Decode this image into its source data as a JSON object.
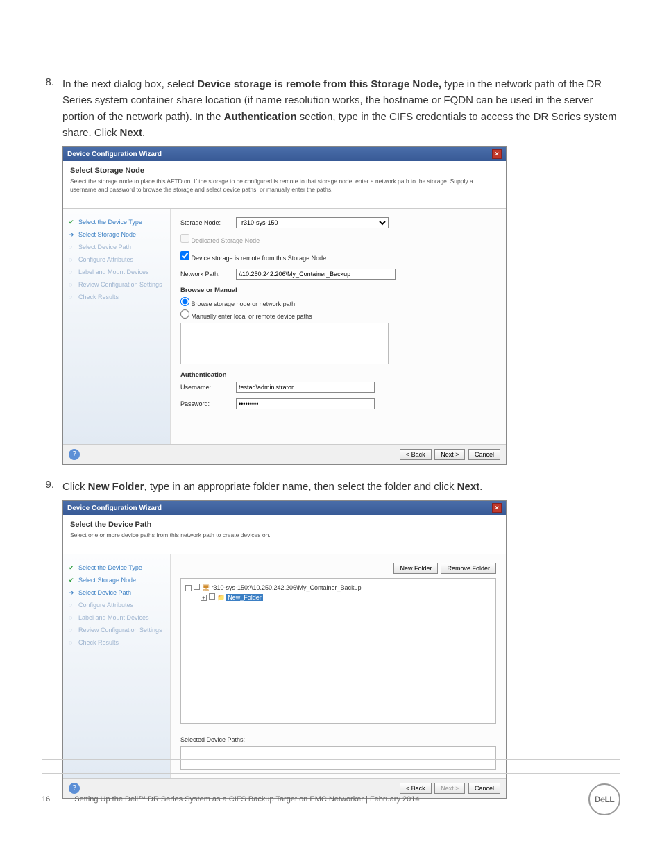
{
  "steps": {
    "s8": {
      "num": "8.",
      "text_parts": [
        "In the next dialog box, select ",
        "Device storage is remote from this Storage Node,",
        " type in the network path of the DR Series system container share location (if name resolution works, the hostname or FQDN can be used in the server portion of the network path). In the ",
        "Authentication",
        " section, type in the CIFS credentials to access the DR Series system share. Click ",
        "Next",
        "."
      ]
    },
    "s9": {
      "num": "9.",
      "text_parts": [
        "Click ",
        "New Folder",
        ", type in an appropriate folder name, then select the folder and click ",
        "Next",
        "."
      ]
    }
  },
  "wizard1": {
    "window_title": "Device Configuration Wizard",
    "header_title": "Select Storage Node",
    "header_sub": "Select the storage node to place this AFTD on. If the storage to be configured is remote to that storage node, enter a network path to the storage. Supply a username and password to browse the storage and select device paths, or manually enter the paths.",
    "side": [
      {
        "label": "Select the Device Type",
        "state": "done"
      },
      {
        "label": "Select Storage Node",
        "state": "current"
      },
      {
        "label": "Select Device Path",
        "state": ""
      },
      {
        "label": "Configure Attributes",
        "state": ""
      },
      {
        "label": "Label and Mount Devices",
        "state": ""
      },
      {
        "label": "Review Configuration Settings",
        "state": ""
      },
      {
        "label": "Check Results",
        "state": ""
      }
    ],
    "storage_node_label": "Storage Node:",
    "storage_node_value": "r310-sys-150",
    "dedicated_label": "Dedicated Storage Node",
    "remote_label": "Device storage is remote from this Storage Node.",
    "network_path_label": "Network Path:",
    "network_path_value": "\\\\10.250.242.206\\My_Container_Backup",
    "browse_section": "Browse or Manual",
    "radio_browse": "Browse storage node or network path",
    "radio_manual": "Manually enter local or remote device paths",
    "auth_section": "Authentication",
    "username_label": "Username:",
    "username_value": "testad\\administrator",
    "password_label": "Password:",
    "password_value": "•••••••••",
    "btn_back": "< Back",
    "btn_next": "Next >",
    "btn_cancel": "Cancel"
  },
  "wizard2": {
    "window_title": "Device Configuration Wizard",
    "header_title": "Select the Device Path",
    "header_sub": "Select one or more device paths from this network path to create devices on.",
    "side": [
      {
        "label": "Select the Device Type",
        "state": "done"
      },
      {
        "label": "Select Storage Node",
        "state": "done"
      },
      {
        "label": "Select Device Path",
        "state": "current"
      },
      {
        "label": "Configure Attributes",
        "state": ""
      },
      {
        "label": "Label and Mount Devices",
        "state": ""
      },
      {
        "label": "Review Configuration Settings",
        "state": ""
      },
      {
        "label": "Check Results",
        "state": ""
      }
    ],
    "btn_new_folder": "New Folder",
    "btn_remove_folder": "Remove Folder",
    "tree_root": "r310-sys-150:\\\\10.250.242.206\\My_Container_Backup",
    "tree_child": "New_Folder",
    "selected_paths_label": "Selected Device Paths:",
    "btn_back": "< Back",
    "btn_next": "Next >",
    "btn_cancel": "Cancel"
  },
  "footer": {
    "page_num": "16",
    "doc_title": "Setting Up the Dell™ DR Series System as a CIFS Backup Target on EMC Networker | February 2014",
    "logo_text": "D℮LL"
  }
}
